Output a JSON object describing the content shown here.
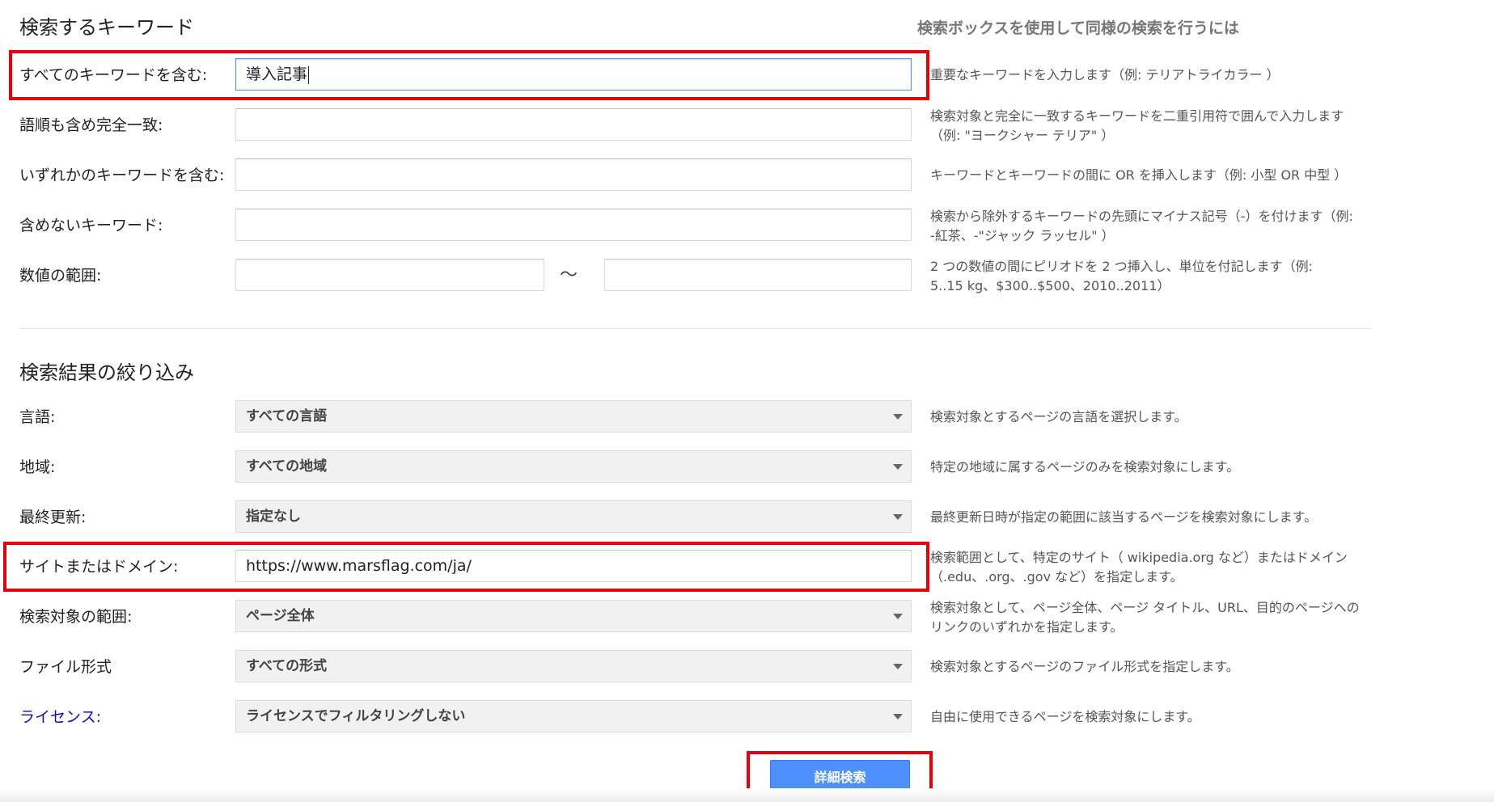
{
  "keywords_section": {
    "title": "検索するキーワード",
    "help_heading": "検索ボックスを使用して同様の検索を行うには"
  },
  "keyword_rows": [
    {
      "label": "すべてのキーワードを含む:",
      "value": "導入記事",
      "help": "重要なキーワードを入力します（例: テリアトライカラー ）"
    },
    {
      "label": "語順も含め完全一致:",
      "value": "",
      "help_line1": "検索対象と完全に一致するキーワードを二重引用符で囲んで入力します",
      "help_line2": "（例: \"ヨークシャー テリア\" ）"
    },
    {
      "label": "いずれかのキーワードを含む:",
      "value": "",
      "help": "キーワードとキーワードの間に OR を挿入します（例: 小型 OR 中型 ）"
    },
    {
      "label": "含めないキーワード:",
      "value": "",
      "help_line1": "検索から除外するキーワードの先頭にマイナス記号（-）を付けます（例:",
      "help_line2": "-紅茶、-\"ジャック ラッセル\" ）"
    },
    {
      "label": "数値の範囲:",
      "value_from": "",
      "value_to": "",
      "separator": "〜",
      "help_line1": "2 つの数値の間にピリオドを 2 つ挿入し、単位を付記します（例:",
      "help_line2": "5..15 kg、$300..$500、2010..2011）"
    }
  ],
  "refine_section": {
    "title": "検索結果の絞り込み"
  },
  "refine_rows": [
    {
      "label": "言語:",
      "selected": "すべての言語",
      "help": "検索対象とするページの言語を選択します。"
    },
    {
      "label": "地域:",
      "selected": "すべての地域",
      "help": "特定の地域に属するページのみを検索対象にします。"
    },
    {
      "label": "最終更新:",
      "selected": "指定なし",
      "help": "最終更新日時が指定の範囲に該当するページを検索対象にします。"
    },
    {
      "label": "サイトまたはドメイン:",
      "value": "https://www.marsflag.com/ja/",
      "help_line1": "検索範囲として、特定のサイト（ wikipedia.org など）またはドメイン",
      "help_line2": "（.edu、.org、.gov など）を指定します。"
    },
    {
      "label": "検索対象の範囲:",
      "selected": "ページ全体",
      "help_line1": "検索対象として、ページ全体、ページ タイトル、URL、目的のページへの",
      "help_line2": "リンクのいずれかを指定します。"
    },
    {
      "label": "ファイル形式",
      "selected": "すべての形式",
      "help": "検索対象とするページのファイル形式を指定します。"
    },
    {
      "label": "ライセンス",
      "label_suffix": ":",
      "selected": "ライセンスでフィルタリングしない",
      "help": "自由に使用できるページを検索対象にします。"
    }
  ],
  "submit": {
    "label": "詳細検索"
  },
  "colors": {
    "highlight": "#e8000b",
    "primary_button": "#4d90fe",
    "link": "#1a0dab"
  },
  "icons": {
    "select_arrow": "chevron-down-icon"
  }
}
